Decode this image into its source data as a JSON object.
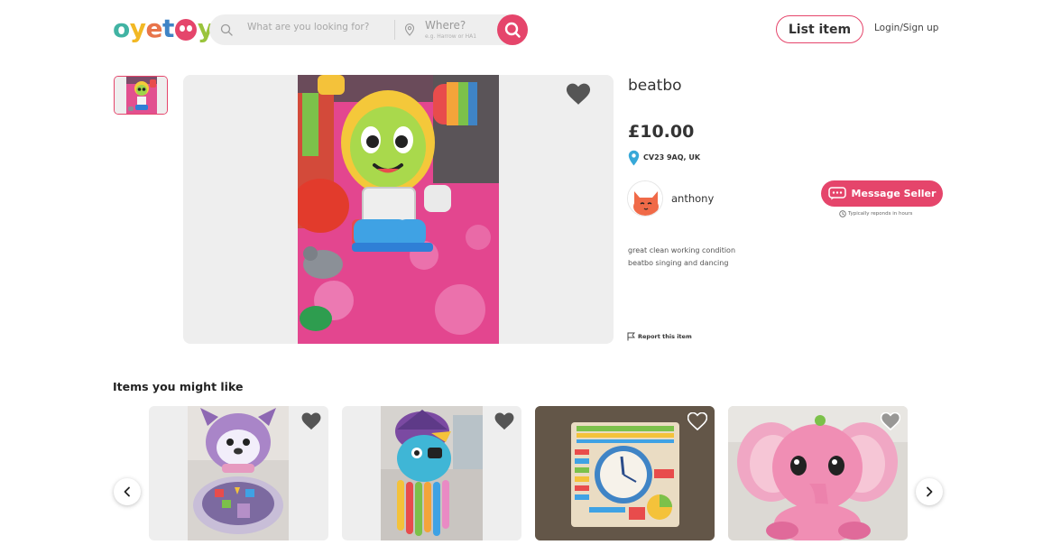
{
  "header": {
    "logo_letters": [
      "o",
      "y",
      "e",
      "t",
      "y"
    ],
    "search_placeholder": "What are you looking for?",
    "where_title": "Where?",
    "where_hint": "e.g. Harrow or HA1",
    "list_item_label": "List item",
    "login_label": "Login/Sign up"
  },
  "product": {
    "title": "beatbo",
    "price": "£10.00",
    "location": "CV23 9AQ, UK",
    "seller_name": "anthony",
    "message_button_label": "Message Seller",
    "reply_note": "Typically reponds in hours",
    "description_lines": [
      "great clean working condition",
      "beatbo singing and dancing"
    ],
    "report_label": "Report this item"
  },
  "recommendations": {
    "title": "Items you might like"
  },
  "colors": {
    "accent": "#e5456b",
    "panel": "#eeeeee",
    "logo": [
      "#41b3a3",
      "#f2b824",
      "#e8744a",
      "#3f84c6",
      "#9ac43c"
    ]
  }
}
